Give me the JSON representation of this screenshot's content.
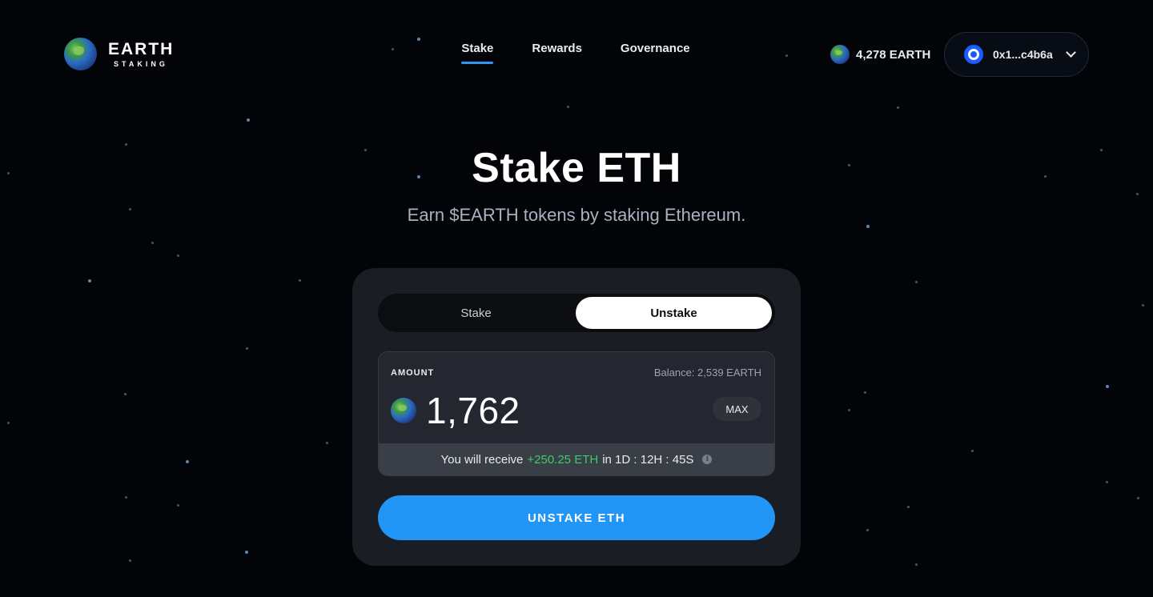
{
  "brand": {
    "title": "EARTH",
    "subtitle": "STAKING"
  },
  "nav": {
    "items": [
      {
        "label": "Stake",
        "active": true
      },
      {
        "label": "Rewards",
        "active": false
      },
      {
        "label": "Governance",
        "active": false
      }
    ]
  },
  "header": {
    "earth_balance": "4,278 EARTH",
    "wallet_address": "0x1...c4b6a"
  },
  "hero": {
    "title": "Stake ETH",
    "subtitle": "Earn $EARTH tokens by staking Ethereum."
  },
  "card": {
    "tabs": [
      {
        "label": "Stake",
        "active": false
      },
      {
        "label": "Unstake",
        "active": true
      }
    ],
    "amount_label": "AMOUNT",
    "balance_text": "Balance: 2,539 EARTH",
    "amount_value": "1,762",
    "max_label": "MAX",
    "receive_prefix": "You will receive",
    "receive_amount": "+250.25 ETH",
    "receive_suffix": "in 1D : 12H : 45S",
    "cta_label": "UNSTAKE ETH"
  },
  "colors": {
    "accent": "#2196f6",
    "positive": "#3dcc6a",
    "background": "#020408",
    "card": "#1a1d23"
  },
  "icons": [
    "earth-logo-icon",
    "earth-token-icon",
    "wallet-icon",
    "chevron-down-icon",
    "info-icon"
  ]
}
